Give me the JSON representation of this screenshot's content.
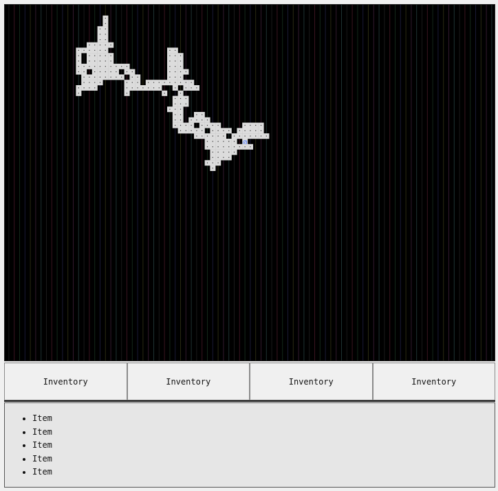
{
  "game": {
    "player_glyph": "@",
    "floor_glyph": "·",
    "colors": {
      "background": "#000000",
      "floor": "#dcdcdc",
      "floor_dot": "#333333",
      "player": "#4a78ff",
      "stripes": [
        "#1a1a1a",
        "#3a1420",
        "#14281a",
        "#1a1a36",
        "#2a2a12",
        "#331a2e",
        "#1e3333"
      ]
    },
    "dungeon_rows": [
      "..................................................................................",
      "..................................................................................",
      "..................#...............................................................",
      "..................#...............................................................",
      ".................##...............................................................",
      ".................##...............................................................",
      ".................##...............................................................",
      "...............#####..............................................................",
      ".............######...........##..................................................",
      ".............#.#####..........###.................................................",
      ".............#.#####..........###.................................................",
      ".............##########.......###.................................................",
      ".............##.#####.##......####................................................",
      "..............########.##.....###.................................................",
      "..............####....###.#########...............................................",
      ".............####.....#######..#.###..............................................",
      ".............#........#......#..#.................................................",
      "...............................###................................................",
      "...............................###................................................",
      "..............................###.................................................",
      "...............................##..##.............................................",
      "...............................##.####............................................",
      "...............................####.####....####..................................",
      "................................#####.####.#####..................................",
      "...................................######.#######.................................",
      ".....................................######.@.....................................",
      ".....................................#########.....................................",
      "......................................#####.......................................",
      "......................................####........................................",
      ".....................................###..........................................",
      "......................................#...........................................",
      ".................................................................................."
    ]
  },
  "tabs": [
    "Inventory",
    "Inventory",
    "Inventory",
    "Inventory"
  ],
  "inventory": {
    "items": [
      "Item",
      "Item",
      "Item",
      "Item",
      "Item"
    ]
  }
}
